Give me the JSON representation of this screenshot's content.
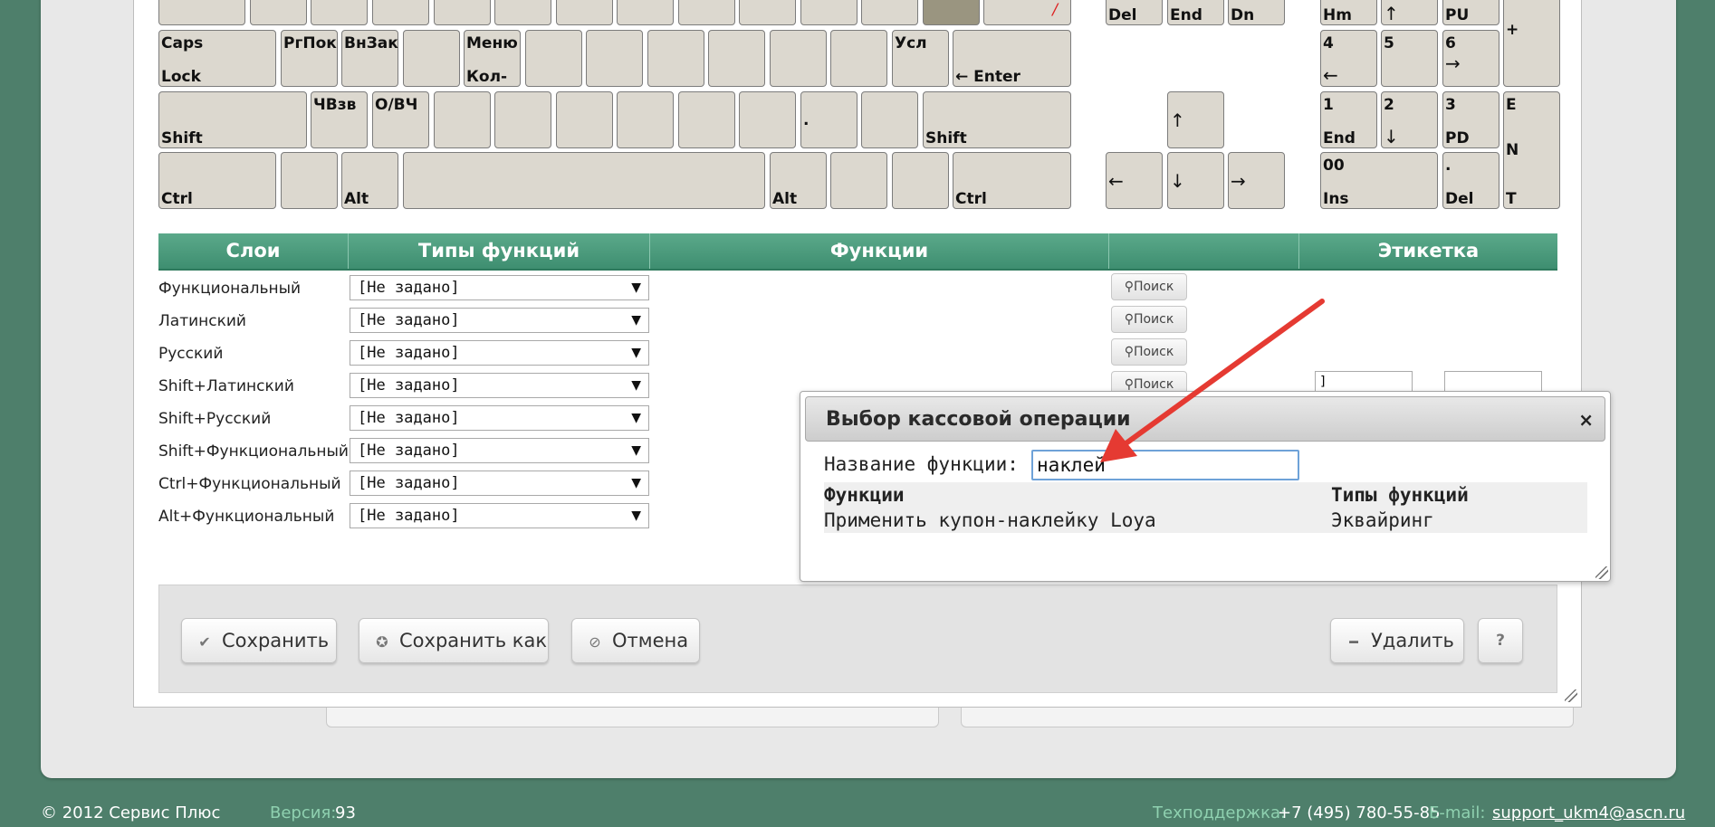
{
  "keyboard": {
    "row0": {
      "del": "Del",
      "end": "End",
      "dn": "Dn",
      "hm": "Hm",
      "up": "↑",
      "pu": "PU",
      "plus": "+",
      "slash": "/"
    },
    "row1": {
      "caps_top": "Caps",
      "caps_bottom": "Lock",
      "k1": "РгПок",
      "k2": "ВнЗак",
      "menu_top": "Меню",
      "menu_bottom": "Кол-",
      "usl": "Усл",
      "enter": "← Enter",
      "n4_top": "4",
      "n4_bottom": "←",
      "n5": "5",
      "n6_top": "6",
      "n6_bottom": "→"
    },
    "row2": {
      "shift_l": "Shift",
      "k1": "ЧВзв",
      "k2": "О/ВЧ",
      "dot": ".",
      "shift_r": "Shift",
      "arrow_up": "↑",
      "n1_top": "1",
      "n1_bottom": "End",
      "n2_top": "2",
      "n2_bottom": "↓",
      "n3_top": "3",
      "n3_bottom": "PD",
      "enter_e": "E",
      "enter_n": "N",
      "enter_t": "T"
    },
    "row3": {
      "ctrl_l": "Ctrl",
      "alt_l": "Alt",
      "alt_r": "Alt",
      "ctrl_r": "Ctrl",
      "arrow_left": "←",
      "arrow_down": "↓",
      "arrow_right": "→",
      "n00_top": "00",
      "n00_bottom": "Ins",
      "ndot_top": ".",
      "ndot_bottom": "Del"
    }
  },
  "table": {
    "headers": [
      "Слои",
      "Типы функций",
      "Функции",
      "",
      "Этикетка"
    ],
    "rows": [
      {
        "layer": "Функциональный",
        "type": "[Не задано]",
        "search": "Поиск"
      },
      {
        "layer": "Латинский",
        "type": "[Не задано]",
        "search": "Поиск"
      },
      {
        "layer": "Русский",
        "type": "[Не задано]",
        "search": "Поиск"
      },
      {
        "layer": "Shift+Латинский",
        "type": "[Не задано]",
        "search": "Поиск"
      },
      {
        "layer": "Shift+Русский",
        "type": "[Не задано]"
      },
      {
        "layer": "Shift+Функциональный",
        "type": "[Не задано]"
      },
      {
        "layer": "Ctrl+Функциональный",
        "type": "[Не задано]"
      },
      {
        "layer": "Alt+Функциональный",
        "type": "[Не задано]"
      }
    ],
    "label_value": "]"
  },
  "buttons": {
    "save": "Сохранить",
    "save_as": "Сохранить как",
    "cancel": "Отмена",
    "delete": "Удалить",
    "help": "?"
  },
  "modal": {
    "title": "Выбор кассовой операции",
    "close": "×",
    "function_name_label": "Название функции:",
    "function_name_value": "наклей",
    "col_functions": "Функции",
    "col_types": "Типы функций",
    "result_function": "Применить купон-наклейку Loya",
    "result_type": "Эквайринг"
  },
  "footer": {
    "copyright": "© 2012 Сервис Плюс",
    "version_label": "Версия:",
    "version_value": "93",
    "support_label": "Техподдержка:",
    "support_phone": "+7 (495) 780-55-85",
    "email_label": "E-mail:",
    "email_value": "support_ukm4@ascn.ru"
  },
  "colors": {
    "background": "#4e7f6b",
    "header_green": "#4a9c7d",
    "annotation_red": "#e53a32",
    "footer_accent": "#8fd1b0"
  }
}
